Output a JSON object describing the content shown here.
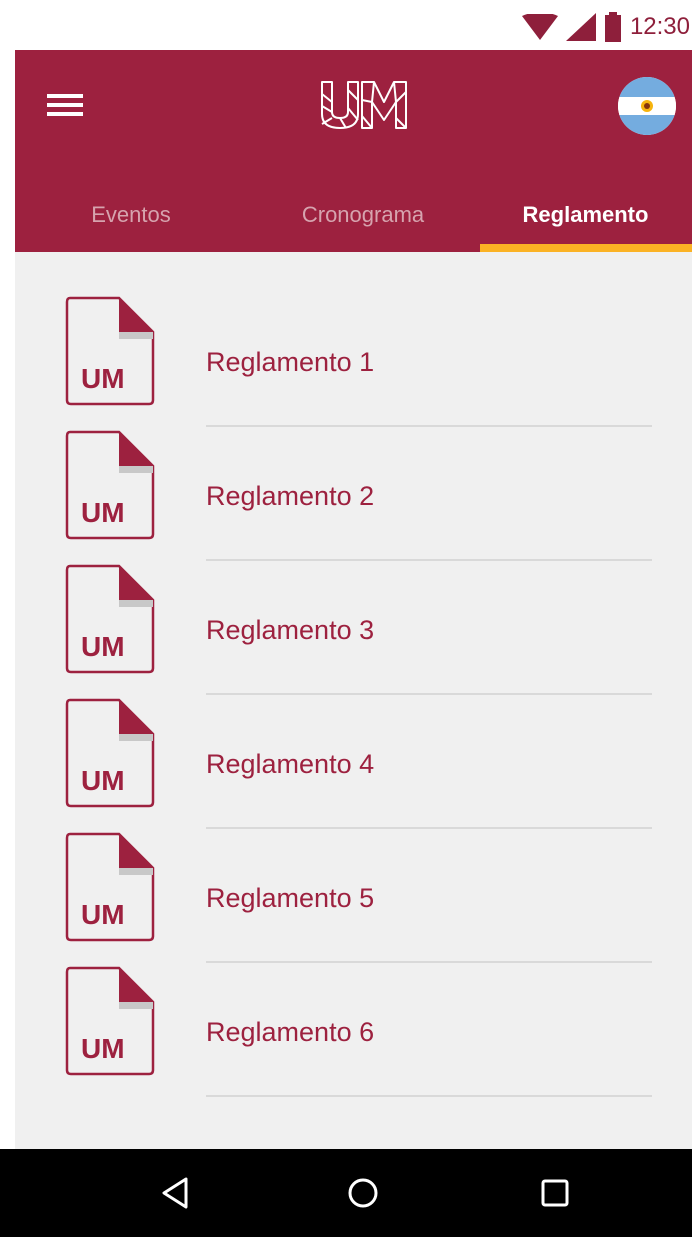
{
  "status_bar": {
    "time": "12:30",
    "icons": [
      "wifi-icon",
      "signal-icon",
      "battery-icon"
    ]
  },
  "app_bar": {
    "menu_icon": "hamburger-menu-icon",
    "logo_text": "UM",
    "flag_icon": "argentina-flag-icon",
    "background_color": "#9d213f"
  },
  "tabs": [
    {
      "label": "Eventos",
      "active": false
    },
    {
      "label": "Cronograma",
      "active": false
    },
    {
      "label": "Reglamento",
      "active": true
    }
  ],
  "tab_indicator_color": "#fbb224",
  "reglamentos": [
    {
      "label": "Reglamento 1",
      "icon": "um-document-icon"
    },
    {
      "label": "Reglamento 2",
      "icon": "um-document-icon"
    },
    {
      "label": "Reglamento 3",
      "icon": "um-document-icon"
    },
    {
      "label": "Reglamento 4",
      "icon": "um-document-icon"
    },
    {
      "label": "Reglamento 5",
      "icon": "um-document-icon"
    },
    {
      "label": "Reglamento 6",
      "icon": "um-document-icon"
    }
  ],
  "doc_icon_text": "UM",
  "nav_bar": {
    "buttons": [
      "back-icon",
      "home-icon",
      "recents-icon"
    ]
  }
}
